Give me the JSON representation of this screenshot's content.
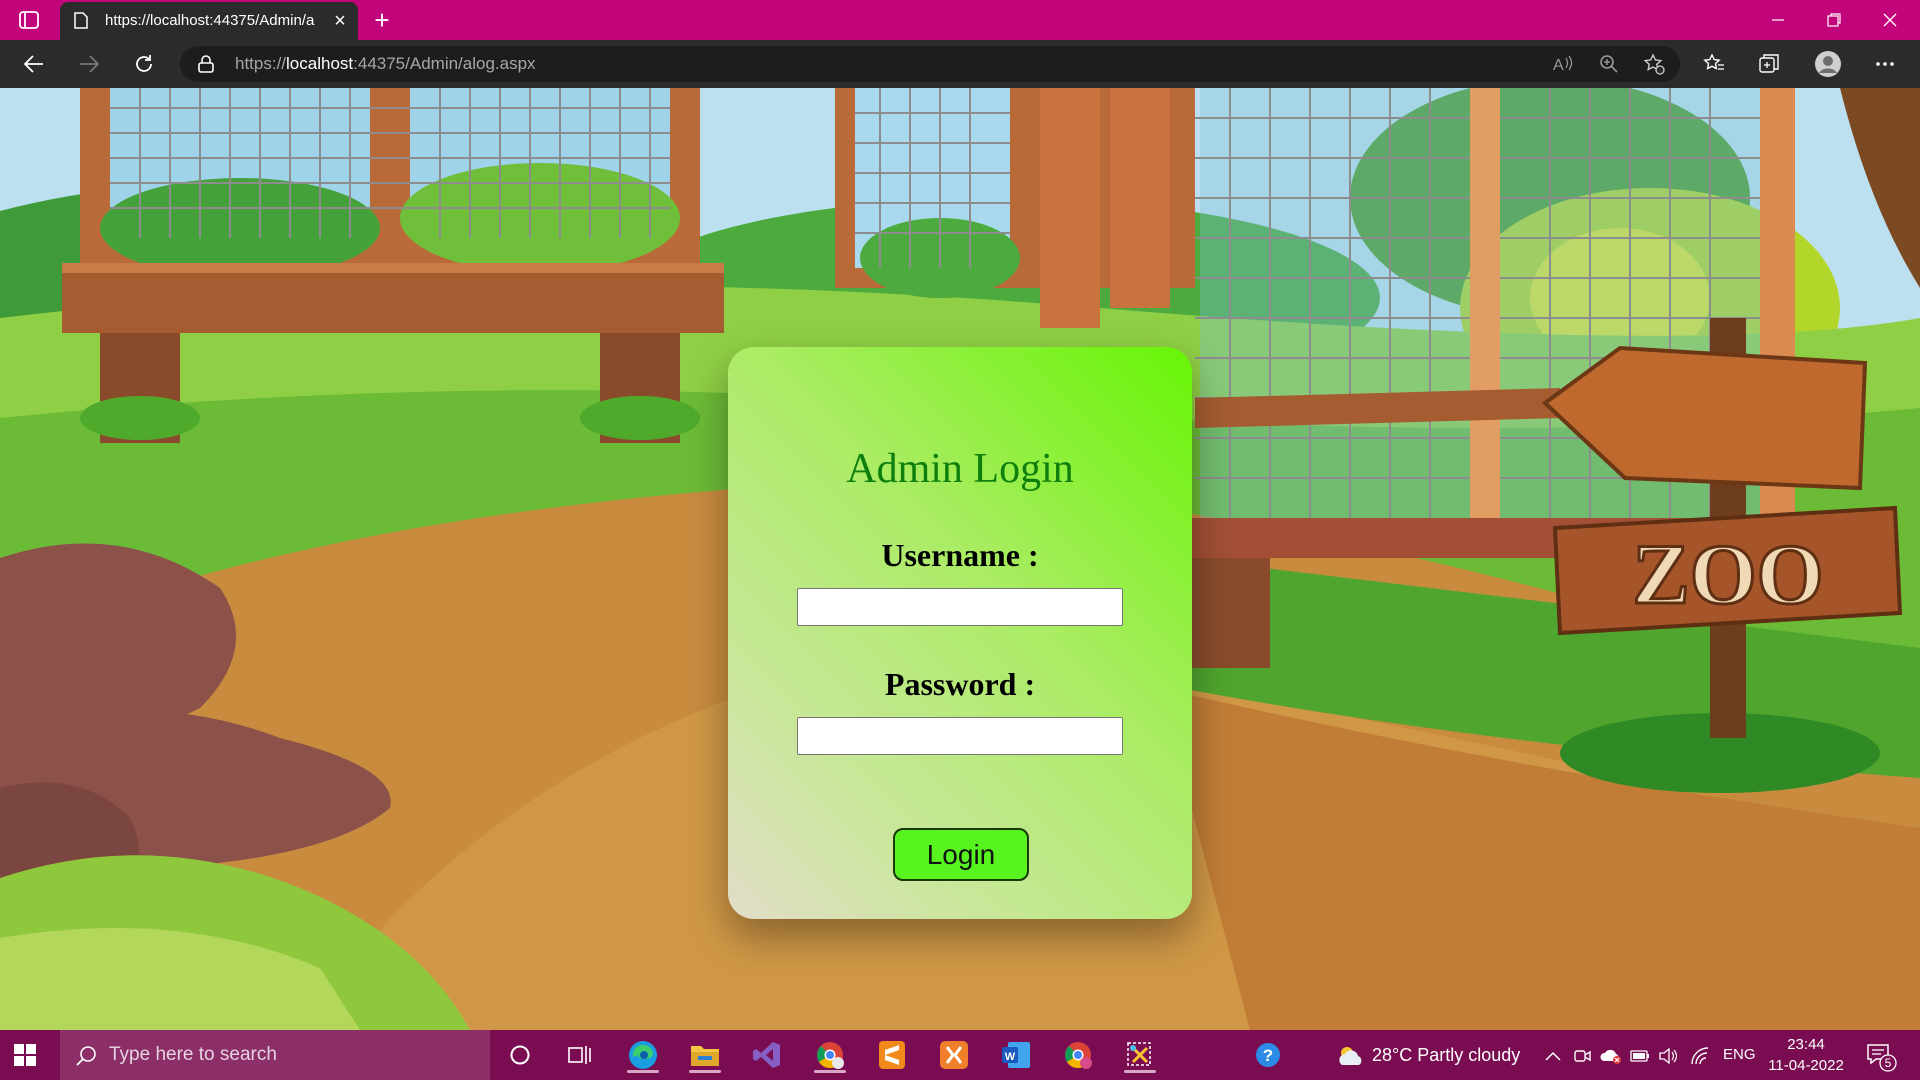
{
  "browser": {
    "tab_title": "https://localhost:44375/Admin/a",
    "url_prefix": "https://",
    "url_host": "localhost",
    "url_rest": ":44375/Admin/alog.aspx"
  },
  "login": {
    "title": "Admin Login",
    "username_label": "Username :",
    "username_value": "",
    "password_label": "Password :",
    "password_value": "",
    "button_label": "Login"
  },
  "scene": {
    "sign_text": "ZOO"
  },
  "taskbar": {
    "search_placeholder": "Type here to search",
    "weather": "28°C  Partly cloudy",
    "language": "ENG",
    "time": "23:44",
    "date": "11-04-2022",
    "notification_count": "5"
  },
  "colors": {
    "titlebar": "#c3057b",
    "taskbar": "#7a0d52",
    "card_title": "#0e7f0c",
    "login_button": "#57f41f"
  }
}
